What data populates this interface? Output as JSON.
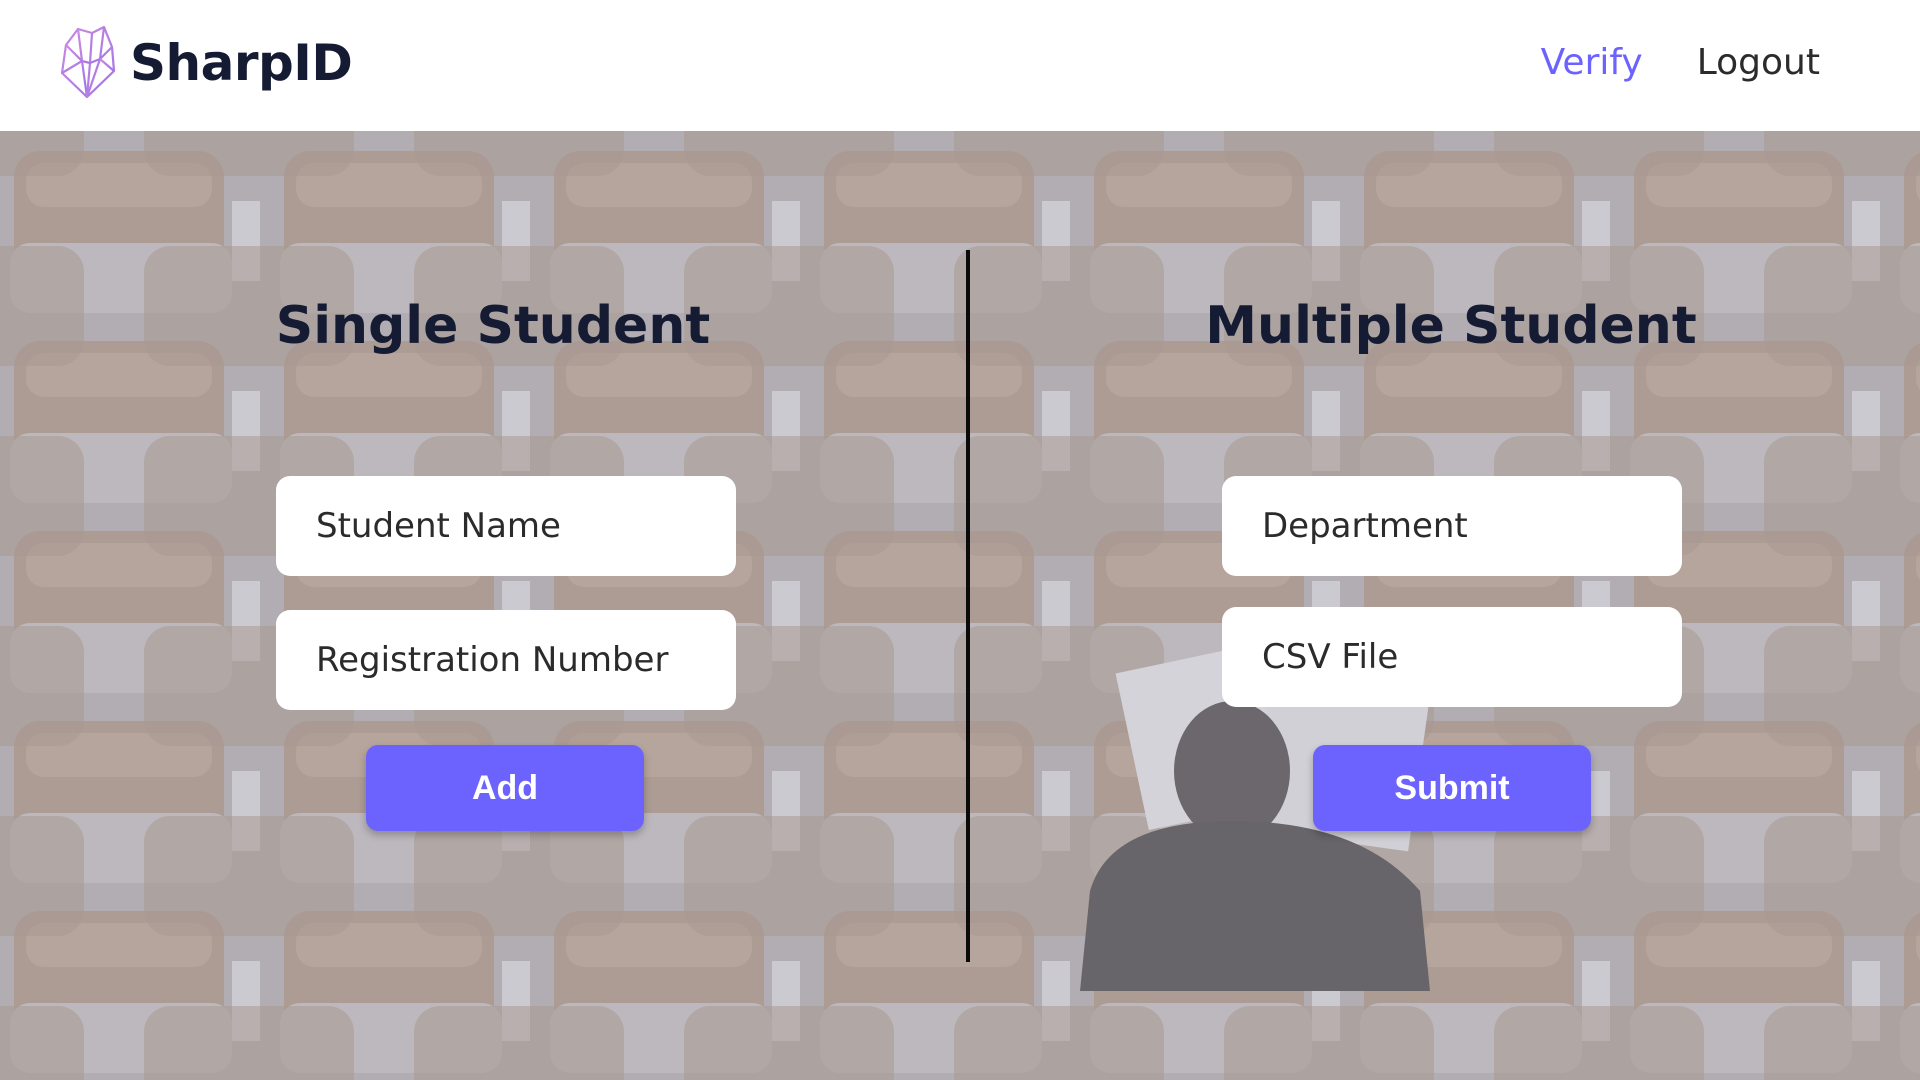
{
  "app": {
    "name": "SharpID",
    "logo_icon": "crystal-icon",
    "accent_color": "#6c63ff"
  },
  "nav": {
    "verify_label": "Verify",
    "logout_label": "Logout"
  },
  "single": {
    "title": "Single Student",
    "name_placeholder": "Student Name",
    "name_value": "",
    "reg_placeholder": "Registration Number",
    "reg_value": "",
    "add_label": "Add"
  },
  "multiple": {
    "title": "Multiple Student",
    "dept_placeholder": "Department",
    "dept_value": "",
    "csv_placeholder": "CSV File",
    "csv_value": "",
    "submit_label": "Submit"
  }
}
